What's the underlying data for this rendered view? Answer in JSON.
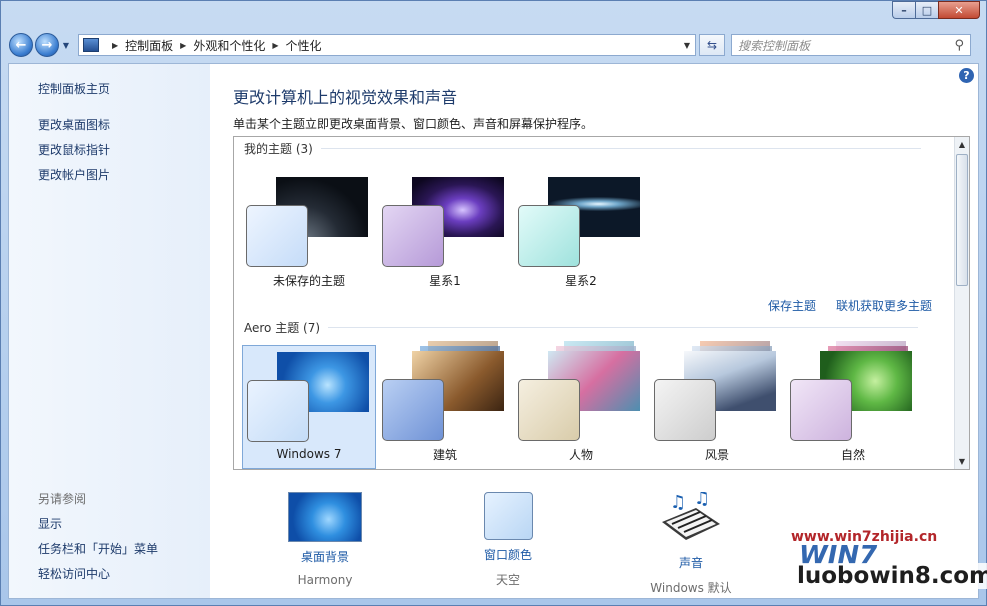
{
  "window": {
    "caption": {
      "min": "–",
      "max": "□",
      "close": "✕"
    }
  },
  "nav": {
    "back": "←",
    "forward": "→",
    "breadcrumb": [
      "控制面板",
      "外观和个性化",
      "个性化"
    ],
    "refresh": "⇆",
    "search_placeholder": "搜索控制面板"
  },
  "sidebar": {
    "home": "控制面板主页",
    "items": [
      "更改桌面图标",
      "更改鼠标指针",
      "更改帐户图片"
    ],
    "see_also_title": "另请参阅",
    "see_also": [
      "显示",
      "任务栏和「开始」菜单",
      "轻松访问中心"
    ]
  },
  "main": {
    "title": "更改计算机上的视觉效果和声音",
    "subtitle": "单击某个主题立即更改桌面背景、窗口颜色、声音和屏幕保护程序。",
    "my_themes_header": "我的主题 (3)",
    "my_themes": [
      {
        "name": "未保存的主题",
        "swatch": "#d8e7fb",
        "bg": "#10161e"
      },
      {
        "name": "星系1",
        "swatch": "#c9b4e6",
        "bg": "#2a1654"
      },
      {
        "name": "星系2",
        "swatch": "#b5ece9",
        "bg": "#0c1828"
      }
    ],
    "save_theme": "保存主题",
    "get_more": "联机获取更多主题",
    "aero_header": "Aero 主题 (7)",
    "aero_themes": [
      {
        "name": "Windows 7",
        "swatch": "#d7e8fb",
        "bg": "#1a6fc8",
        "selected": true
      },
      {
        "name": "建筑",
        "swatch": "#8fb0e6",
        "bg": "#3e5e94",
        "selected": false
      },
      {
        "name": "人物",
        "swatch": "#ece2c8",
        "bg": "#5f9fb5",
        "selected": false
      },
      {
        "name": "风景",
        "swatch": "#e4e4e4",
        "bg": "#6a7c9a",
        "selected": false
      },
      {
        "name": "自然",
        "swatch": "#e1d0ec",
        "bg": "#3d8a3a",
        "selected": false
      }
    ],
    "bottom": [
      {
        "label": "桌面背景",
        "value": "Harmony"
      },
      {
        "label": "窗口颜色",
        "value": "天空"
      },
      {
        "label": "声音",
        "value": "Windows 默认"
      }
    ],
    "help": "?"
  },
  "watermarks": {
    "site1": "www.win7zhijia.cn",
    "logo": "WIN7",
    "site2": "luobowin8.com"
  }
}
